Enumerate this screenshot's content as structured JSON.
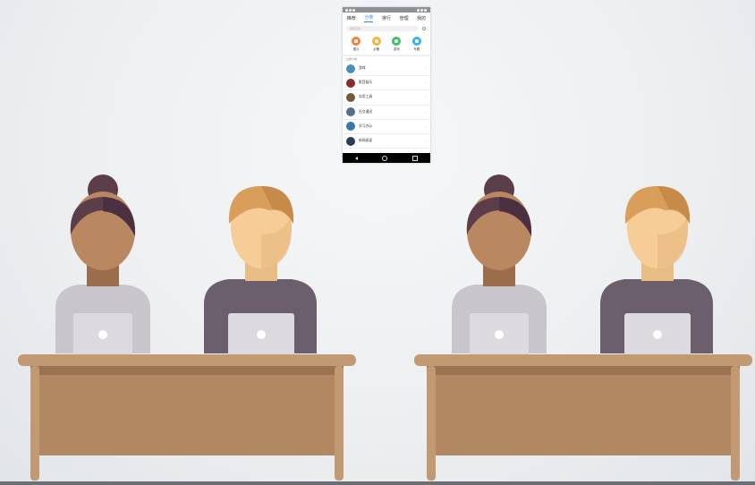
{
  "phone": {
    "tabs": [
      {
        "label": "推荐",
        "active": false
      },
      {
        "label": "分类",
        "active": true
      },
      {
        "label": "排行",
        "active": false
      },
      {
        "label": "管理",
        "active": false
      },
      {
        "label": "我的",
        "active": false
      }
    ],
    "search_placeholder": "搜索应用",
    "categories": [
      {
        "label": "图片",
        "icon": "image-icon",
        "color": "#f57d3c"
      },
      {
        "label": "必备",
        "icon": "star-icon",
        "color": "#f5b53c"
      },
      {
        "label": "游戏",
        "icon": "game-icon",
        "color": "#3cc06a"
      },
      {
        "label": "专题",
        "icon": "topic-icon",
        "color": "#35b6e6"
      }
    ],
    "section_title": "全部分类",
    "list": [
      {
        "name": "游戏",
        "color": "#4a8fb5"
      },
      {
        "name": "影音娱乐",
        "color": "#8a2c2c"
      },
      {
        "name": "实用工具",
        "color": "#6e5a3a"
      },
      {
        "name": "社交通讯",
        "color": "#566f8a"
      },
      {
        "name": "学习办公",
        "color": "#3a77a8"
      },
      {
        "name": "新闻阅读",
        "color": "#2d3d55"
      }
    ]
  },
  "colors": {
    "desk_top": "#c19a74",
    "desk_front": "#b28863",
    "desk_shadow": "#9a7352",
    "laptop": "#dcdadf",
    "woman_skin": "#b98760",
    "woman_hair": "#5c3d4a",
    "woman_shirt": "#c8c6ca",
    "man_skin": "#f6cd96",
    "man_hair": "#d89e5a",
    "man_shirt": "#6b5f6d"
  }
}
